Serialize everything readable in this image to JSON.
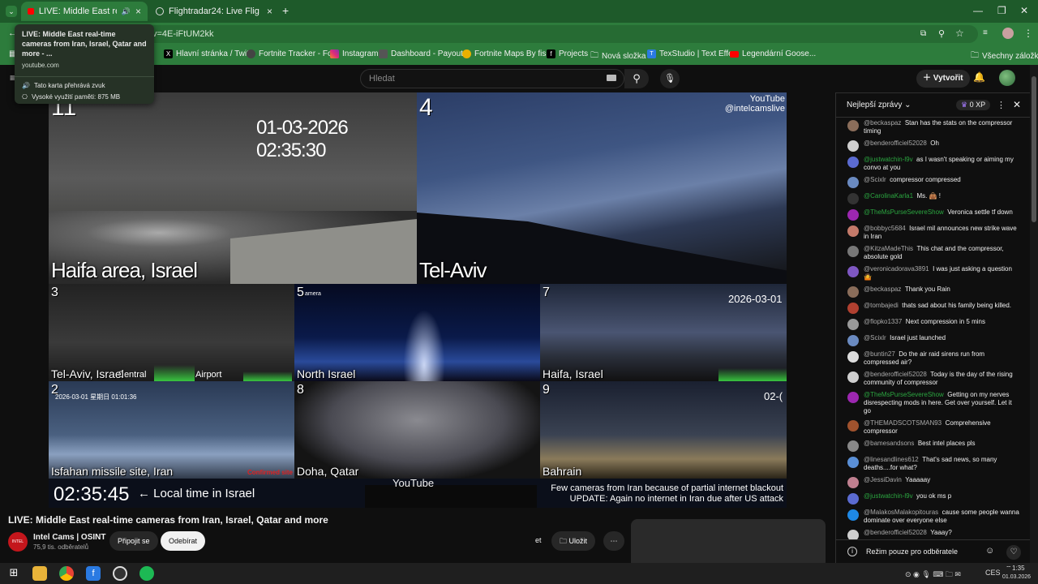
{
  "tabs": [
    {
      "title": "LIVE: Middle East real-time",
      "active": true
    },
    {
      "title": "Flightradar24: Live Flight Tracke",
      "active": false
    }
  ],
  "address": {
    "url_visible": "v=4E-iFtUM2kk"
  },
  "tooltip": {
    "title": "LIVE: Middle East real-time cameras from Iran, Israel, Qatar and more - ...",
    "domain": "youtube.com",
    "audio": "Tato karta přehrává zvuk",
    "memory": "Vysoké využití paměti: 875 MB"
  },
  "bookmarks": [
    "Hlavní stránka / Twit...",
    "Fortnite Tracker - Fo...",
    "Instagram",
    "Dashboard - Payout...",
    "Fortnite Maps By fis...",
    "Projects",
    "Nová složka",
    "TexStudio | Text Effe...",
    "Legendární Goose...",
    "Všechny záložky"
  ],
  "header": {
    "search_placeholder": "Hledat",
    "create_label": "Vytvořit"
  },
  "player": {
    "watermark": "YouTube\n@intelcamslive",
    "cams": [
      {
        "num": "11",
        "label": "Haifa area, Israel",
        "timestamp": "01-03-2026 02:35:30"
      },
      {
        "num": "4",
        "label": "Tel-Aviv"
      },
      {
        "num": "3",
        "label": "Tel-Aviv, Israel",
        "sub1": "Central",
        "sub2": "Airport"
      },
      {
        "num": "5",
        "label": "North Israel",
        "sub1": "amera"
      },
      {
        "num": "7",
        "label": "Haifa, Israel",
        "timestamp": "2026-03-01"
      },
      {
        "num": "2",
        "label": "Isfahan missile site, Iran",
        "timestamp": "2026-03-01  星期日  01:01:36",
        "badge": "Confirmed site"
      },
      {
        "num": "8",
        "label": "Doha, Qatar"
      },
      {
        "num": "9",
        "label": "Bahrain",
        "timestamp": "02-("
      }
    ],
    "clock": "02:35:45",
    "local_time": "← Local time in Israel",
    "note1": "Few cameras from Iran because of partial internet blackout",
    "note2": "UPDATE: Again no internet in Iran due after US attack",
    "youtube_small": "YouTube"
  },
  "video": {
    "title": "LIVE: Middle East real-time cameras from Iran, Israel, Qatar and more",
    "channel": "Intel Cams | OSINT",
    "subscribers": "75,9 tis. odběratelů",
    "join": "Připojit se",
    "subscribe": "Odebírat",
    "save": "Uložit",
    "share_tail": "et"
  },
  "chat": {
    "header": "Nejlepší zprávy",
    "xp": "0 XP",
    "footer": "Režim pouze pro odběratele",
    "messages": [
      {
        "author": "@beckaspaz",
        "text": "Stan has the stats on the compressor timing",
        "color": "#8a6d5a",
        "g": false
      },
      {
        "author": "@benderofficiel52028",
        "text": "Oh",
        "color": "#cfcfcf",
        "g": false
      },
      {
        "author": "@justwatchin-l9v",
        "text": "as I wasn't speaking or aiming my convo at you",
        "color": "#5b6bd1",
        "g": true
      },
      {
        "author": "@Scixlr",
        "text": "compressor compressed",
        "color": "#6a8ac0",
        "g": false
      },
      {
        "author": "@CarolinaKarla1",
        "text": "Ms. 👜 !",
        "color": "#333",
        "g": true
      },
      {
        "author": "@TheMsPurseSevereShow",
        "text": "Veronica settle tf down",
        "color": "#9c27b0",
        "g": true
      },
      {
        "author": "@bobbyc5684",
        "text": "Israel mil announces new strike wave in Iran",
        "color": "#c47a6a",
        "g": false
      },
      {
        "author": "@KitzaMadeThis",
        "text": "This chat and the compressor, absolute gold",
        "color": "#777",
        "g": false
      },
      {
        "author": "@veronicadorava3891",
        "text": "I was just asking a question 🤷",
        "color": "#7e57c2",
        "g": false
      },
      {
        "author": "@beckaspaz",
        "text": "Thank you Rain",
        "color": "#8a6d5a",
        "g": false
      },
      {
        "author": "@tombajedi",
        "text": "thats sad about his family being killed.",
        "color": "#b04030",
        "g": false
      },
      {
        "author": "@flopko1337",
        "text": "Next compression in 5 mins",
        "color": "#999",
        "g": false
      },
      {
        "author": "@Scixlr",
        "text": "Israel just launched",
        "color": "#6a8ac0",
        "g": false
      },
      {
        "author": "@buntin27",
        "text": "Do the air raid sirens run from compressed air?",
        "color": "#ddd",
        "g": false
      },
      {
        "author": "@benderofficiel52028",
        "text": "Today is the day of the rising community of compressor",
        "color": "#cfcfcf",
        "g": false
      },
      {
        "author": "@TheMsPurseSevereShow",
        "text": "Getting on my nerves disrespecting mods in here. Get over yourself. Let it go",
        "color": "#9c27b0",
        "g": true
      },
      {
        "author": "@THEMADSCOTSMAN93",
        "text": "Comprehensive compressor",
        "color": "#a0522d",
        "g": false
      },
      {
        "author": "@bamesandsons",
        "text": "Best intel places pls",
        "color": "#888",
        "g": false
      },
      {
        "author": "@linesandlines612",
        "text": "That's sad news, so many deaths....for what?",
        "color": "#5a8fd6",
        "g": false
      },
      {
        "author": "@JessiDavin",
        "text": "Yaaaaay",
        "color": "#c08090",
        "g": false
      },
      {
        "author": "@justwatchin-l9v",
        "text": "you ok ms p",
        "color": "#5b6bd1",
        "g": true
      },
      {
        "author": "@MalakosMalakopitouras",
        "text": "cause some people wanna dominate over everyone else",
        "color": "#1e88e5",
        "g": false
      },
      {
        "author": "@benderofficiel52028",
        "text": "Yaaay?",
        "color": "#cfcfcf",
        "g": false
      }
    ]
  },
  "taskbar": {
    "time": "1:35",
    "date": "01.03.2026",
    "lang": "CES"
  }
}
